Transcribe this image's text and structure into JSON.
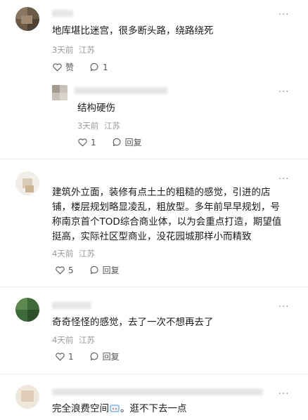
{
  "comments": [
    {
      "text": "地库堪比迷宫，很多断头路，绕路绕死",
      "time": "3天前",
      "location": "江苏",
      "like_label": "赞",
      "reply_count": "1",
      "more": "···",
      "reply": {
        "text": "结构硬伤",
        "time": "3天前",
        "location": "江苏",
        "like_count": "1",
        "reply_label": "回复",
        "more": "···"
      }
    },
    {
      "text_lines": [
        "建筑外立面，装修有点土土的粗糙的感觉，引进的店",
        "铺，楼层规划略显凌乱，粗放型。多年前早早规划，号",
        "称南京首个TOD综合商业体，以为会重点打造，期望值",
        "挺高，实际社区型商业，没花园城那样小而精致"
      ],
      "time": "4天前",
      "location": "江苏",
      "like_count": "5",
      "reply_label": "回复",
      "more": "···"
    },
    {
      "text": "奇奇怪怪的感觉，去了一次不想再去了",
      "time": "4天前",
      "location": "江苏",
      "like_count": "1",
      "reply_label": "回复",
      "more": "···"
    },
    {
      "text_before": "完全浪费空间",
      "text_after": "。逛不下去一点",
      "more": "···"
    }
  ]
}
